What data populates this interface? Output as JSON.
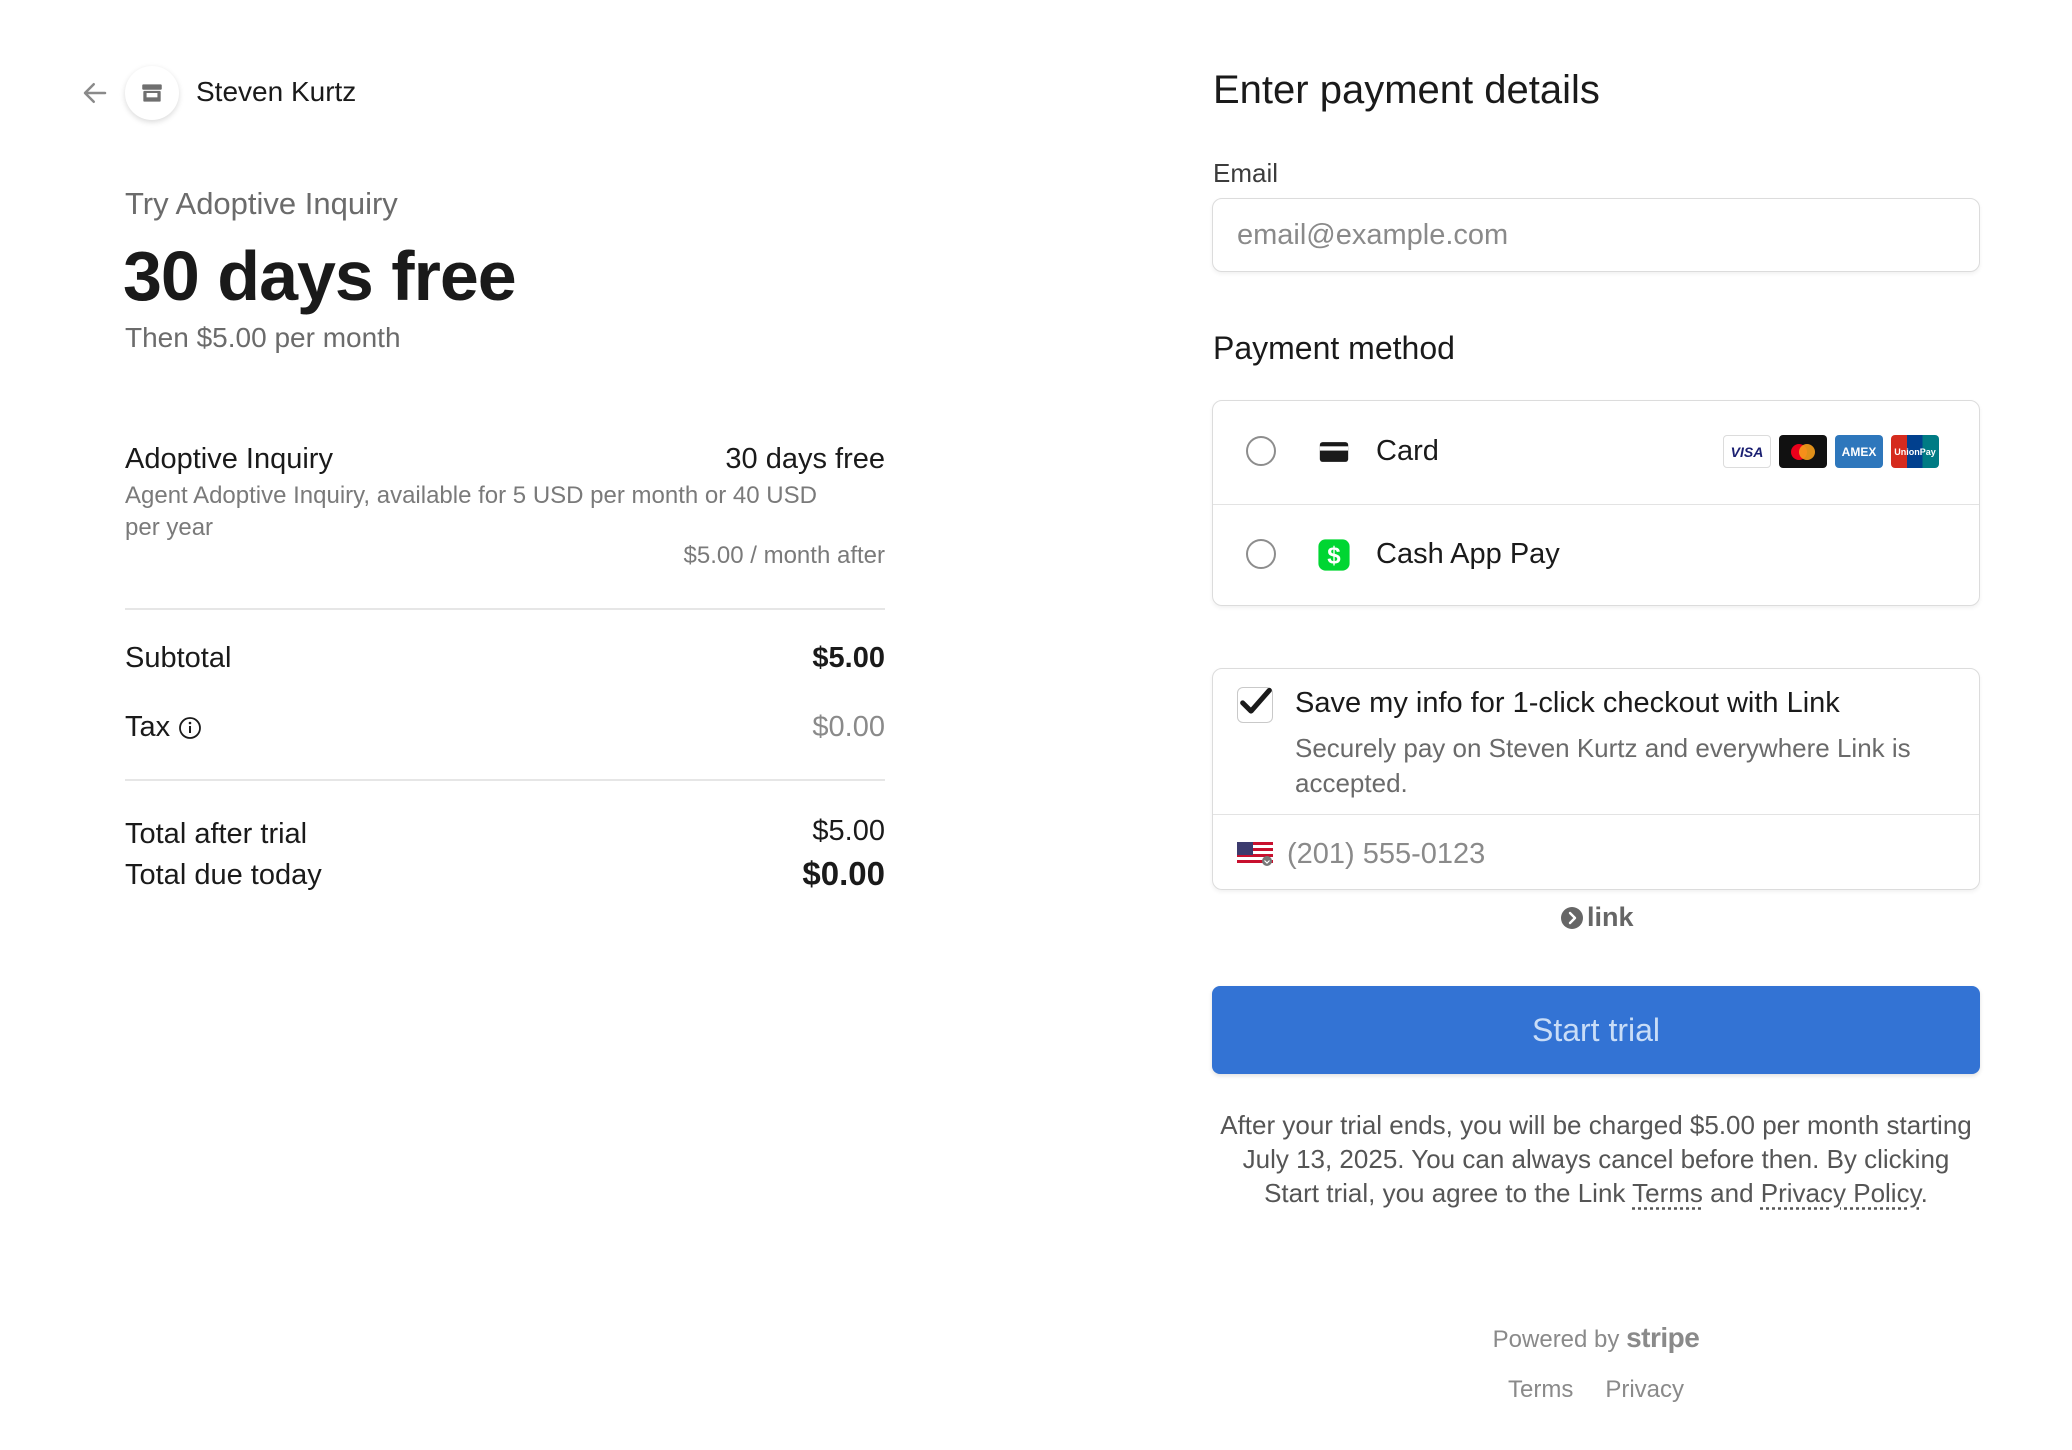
{
  "merchant": {
    "name": "Steven Kurtz"
  },
  "summary": {
    "try_label": "Try Adoptive Inquiry",
    "headline": "30 days free",
    "then_price": "Then $5.00 per month"
  },
  "line_item": {
    "name": "Adoptive Inquiry",
    "price": "30 days free",
    "description": "Agent Adoptive Inquiry, available for 5 USD per month or 40 USD per year",
    "after": "$5.00 / month after"
  },
  "totals": {
    "subtotal_label": "Subtotal",
    "subtotal_value": "$5.00",
    "tax_label": "Tax",
    "tax_value": "$0.00",
    "after_trial_label": "Total after trial",
    "after_trial_value": "$5.00",
    "due_today_label": "Total due today",
    "due_today_value": "$0.00"
  },
  "payment": {
    "title": "Enter payment details",
    "email_label": "Email",
    "email_placeholder": "email@example.com",
    "method_label": "Payment method",
    "methods": [
      {
        "label": "Card",
        "icon": "card-icon",
        "brands": [
          "VISA",
          "Mastercard",
          "AMEX",
          "UnionPay"
        ]
      },
      {
        "label": "Cash App Pay",
        "icon": "cash-app-icon"
      }
    ]
  },
  "link": {
    "checkbox_label": "Save my info for 1-click checkout with Link",
    "description": "Securely pay on Steven Kurtz and everywhere Link is accepted.",
    "phone_placeholder": "(201) 555-0123",
    "logo_text": "link",
    "checked": true
  },
  "cta": {
    "label": "Start trial"
  },
  "fine_print": {
    "text": "After your trial ends, you will be charged $5.00 per month starting July 13, 2025. You can always cancel before then. By clicking Start trial, you agree to the Link ",
    "terms": "Terms",
    "and": " and ",
    "privacy": "Privacy Policy",
    "end": "."
  },
  "footer": {
    "powered_by": "Powered by",
    "stripe": "stripe",
    "terms": "Terms",
    "privacy": "Privacy"
  },
  "colors": {
    "button": "#3373d4",
    "button_text": "#c9ddf7",
    "cash_app": "#00d632"
  }
}
